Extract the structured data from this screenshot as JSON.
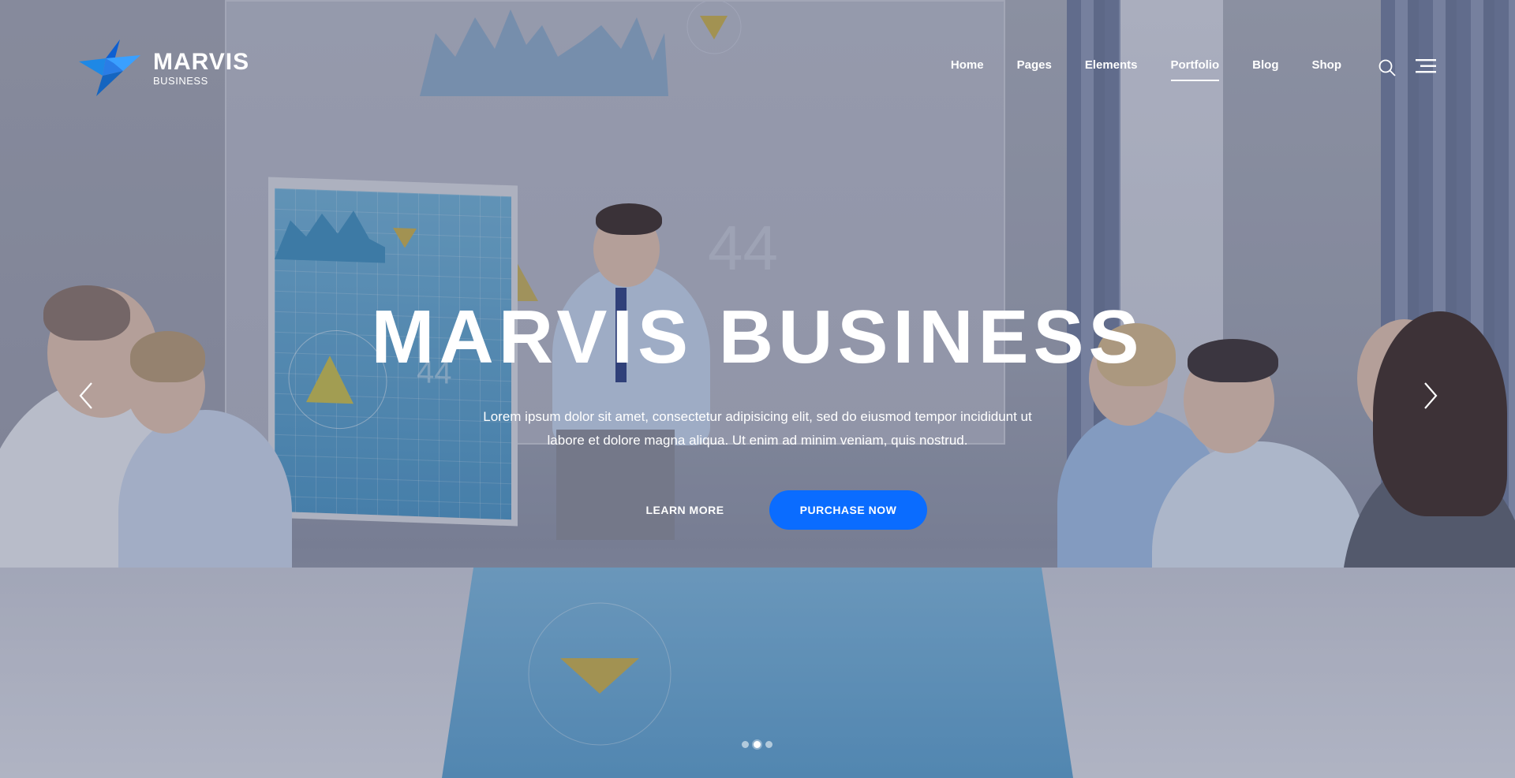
{
  "brand": {
    "title": "MARVIS",
    "subtitle": "BUSINESS"
  },
  "nav": {
    "items": [
      {
        "label": "Home",
        "active": false
      },
      {
        "label": "Pages",
        "active": false
      },
      {
        "label": "Elements",
        "active": false
      },
      {
        "label": "Portfolio",
        "active": true
      },
      {
        "label": "Blog",
        "active": false
      },
      {
        "label": "Shop",
        "active": false
      }
    ],
    "search_icon": "search-icon",
    "menu_icon": "hamburger-menu-icon"
  },
  "hero": {
    "title": "MARVIS BUSINESS",
    "text_line1": "Lorem ipsum dolor sit amet, consectetur adipisicing elit, sed do eiusmod tempor incididunt ut",
    "text_line2": "labore et dolore magna aliqua. Ut enim ad minim veniam, quis nostrud.",
    "learn_more_label": "LEARN MORE",
    "purchase_label": "PURCHASE NOW",
    "prev_icon": "chevron-left-icon",
    "next_icon": "chevron-right-icon"
  },
  "slider": {
    "slides": 3,
    "active_index": 1
  },
  "colors": {
    "accent": "#0a6cff",
    "text": "#ffffff",
    "logo_blue": "#1e88e5"
  }
}
